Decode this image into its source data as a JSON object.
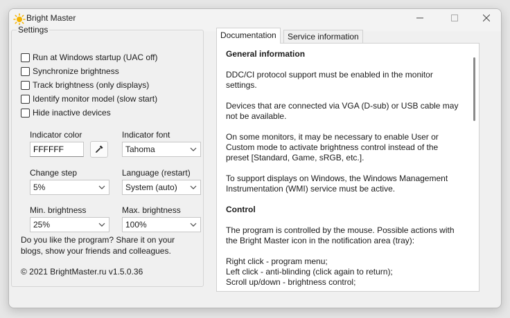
{
  "window": {
    "title": "Bright Master"
  },
  "settings": {
    "group_title": "Settings",
    "checkboxes": [
      {
        "label": "Run at Windows startup (UAC off)",
        "checked": false
      },
      {
        "label": "Synchronize brightness",
        "checked": false
      },
      {
        "label": "Track brightness (only displays)",
        "checked": false
      },
      {
        "label": "Identify monitor model (slow start)",
        "checked": false
      },
      {
        "label": "Hide inactive devices",
        "checked": false
      }
    ],
    "indicator_color": {
      "label": "Indicator color",
      "value": "FFFFFF"
    },
    "indicator_font": {
      "label": "Indicator font",
      "value": "Tahoma"
    },
    "change_step": {
      "label": "Change step",
      "value": "5%"
    },
    "language": {
      "label": "Language (restart)",
      "value": "System (auto)"
    },
    "min_brightness": {
      "label": "Min. brightness",
      "value": "25%"
    },
    "max_brightness": {
      "label": "Max. brightness",
      "value": "100%"
    },
    "share_text": "Do you like the program? Share it on your blogs, show your friends and colleagues.",
    "copyright": "© 2021 BrightMaster.ru v1.5.0.36"
  },
  "tabs": [
    {
      "label": "Documentation",
      "active": true
    },
    {
      "label": "Service information",
      "active": false
    }
  ],
  "documentation": {
    "general_heading": "General information",
    "p1": "DDC/CI protocol support must be enabled in the monitor settings.",
    "p2": "Devices that are connected via VGA (D-sub) or USB cable may not be available.",
    "p3": "On some monitors, it may be necessary to enable User or Custom mode to activate brightness control instead of the preset [Standard, Game, sRGB, etc.].",
    "p4": "To support displays on Windows, the Windows Management Instrumentation (WMI) service must be active.",
    "control_heading": "Control",
    "p5": "The program is controlled by the mouse. Possible actions with the Bright Master icon in the notification area (tray):",
    "line1": "Right click - program menu;",
    "line2": "Left click - anti-blinding (click again to return);",
    "line3": "Scroll up/down - brightness control;"
  },
  "colors": {
    "accent": "#f5b400",
    "window_bg": "#f0f0f0"
  }
}
